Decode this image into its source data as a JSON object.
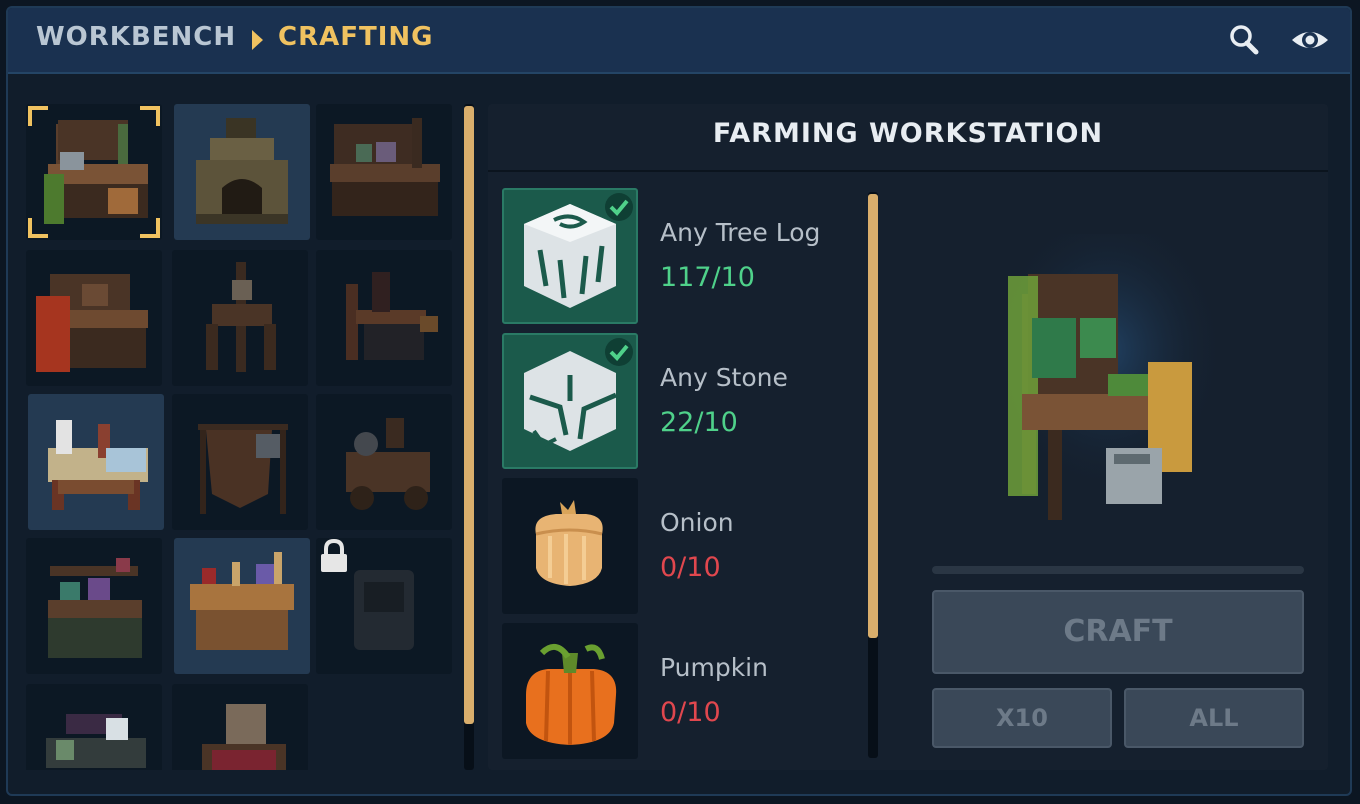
{
  "header": {
    "breadcrumb_root": "WORKBENCH",
    "breadcrumb_current": "CRAFTING",
    "icons": [
      "search-icon",
      "eye-icon"
    ]
  },
  "stations": [
    {
      "name": "farming-workstation",
      "selected": true
    },
    {
      "name": "stone-oven"
    },
    {
      "name": "alchemy-workstation"
    },
    {
      "name": "tailoring-workstation"
    },
    {
      "name": "saddle-stand"
    },
    {
      "name": "forge-workstation"
    },
    {
      "name": "loom-workstation"
    },
    {
      "name": "hide-rack"
    },
    {
      "name": "tinker-cart"
    },
    {
      "name": "dye-workstation"
    },
    {
      "name": "carpentry-workstation"
    },
    {
      "name": "locked-workstation",
      "locked": true
    },
    {
      "name": "jeweler-workstation"
    },
    {
      "name": "bed-station"
    }
  ],
  "detail": {
    "title": "FARMING WORKSTATION",
    "ingredients": [
      {
        "name": "Any Tree Log",
        "count": "117/10",
        "ok": true,
        "icon": "tree-log-icon"
      },
      {
        "name": "Any Stone",
        "count": "22/10",
        "ok": true,
        "icon": "stone-icon"
      },
      {
        "name": "Onion",
        "count": "0/10",
        "ok": false,
        "icon": "onion-icon"
      },
      {
        "name": "Pumpkin",
        "count": "0/10",
        "ok": false,
        "icon": "pumpkin-icon"
      }
    ],
    "preview": "farming-workstation-preview",
    "craft_progress": 0,
    "buttons": {
      "craft": "CRAFT",
      "x10": "X10",
      "all": "ALL"
    }
  },
  "colors": {
    "accent": "#f0c260",
    "ok": "#4fd18a",
    "missing": "#e0474e",
    "header": "#1a3150"
  }
}
